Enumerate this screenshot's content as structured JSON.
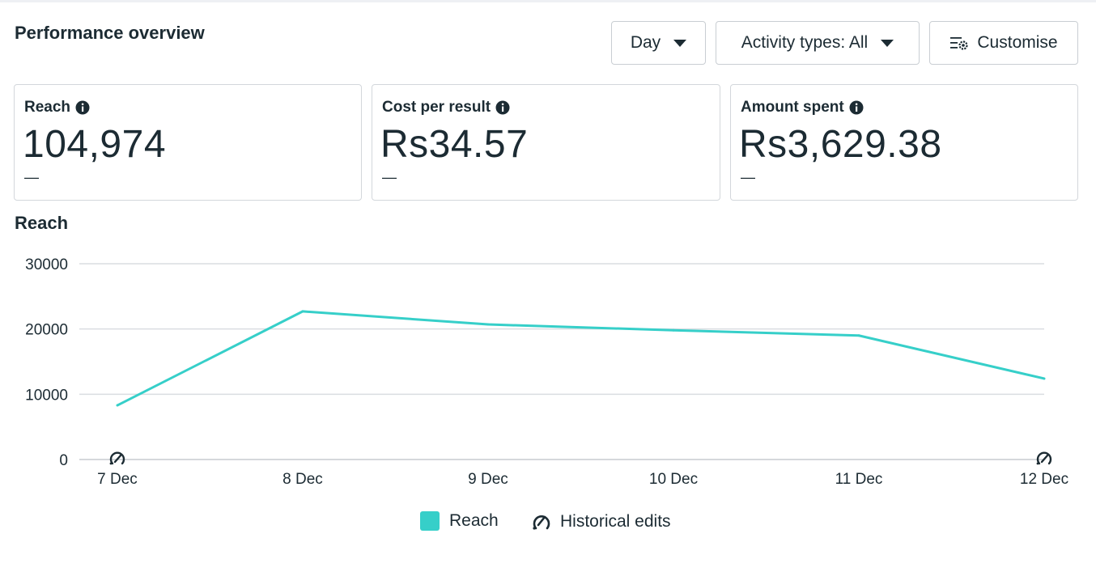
{
  "page": {
    "title": "Performance overview"
  },
  "controls": {
    "day_label": "Day",
    "activity_label": "Activity types: All",
    "customise_label": "Customise"
  },
  "metrics": [
    {
      "label": "Reach",
      "value": "104,974",
      "delta": "—"
    },
    {
      "label": "Cost per result",
      "value": "Rs34.57",
      "delta": "—"
    },
    {
      "label": "Amount spent",
      "value": "Rs3,629.38",
      "delta": "—"
    }
  ],
  "section": {
    "title": "Reach"
  },
  "colors": {
    "reach": "#36cfc9",
    "grid": "#dadde1",
    "text": "#1c2b33",
    "border": "#d3d7db"
  },
  "icons": {
    "info": "info-icon",
    "caret": "caret-down-icon",
    "customise": "customise-icon",
    "historical": "historical-edits-icon"
  },
  "legend": {
    "reach": "Reach",
    "historical": "Historical edits"
  },
  "chart_data": {
    "type": "line",
    "categories": [
      "7 Dec",
      "8 Dec",
      "9 Dec",
      "10 Dec",
      "11 Dec",
      "12 Dec"
    ],
    "series": [
      {
        "name": "Reach",
        "values": [
          8300,
          22700,
          20700,
          19800,
          19000,
          12400
        ]
      }
    ],
    "ylim": [
      0,
      30000
    ],
    "yticks": [
      "0",
      "10000",
      "20000",
      "30000"
    ],
    "grid": true,
    "legend_position": "bottom",
    "historical_edit_markers": [
      "7 Dec",
      "12 Dec"
    ]
  }
}
